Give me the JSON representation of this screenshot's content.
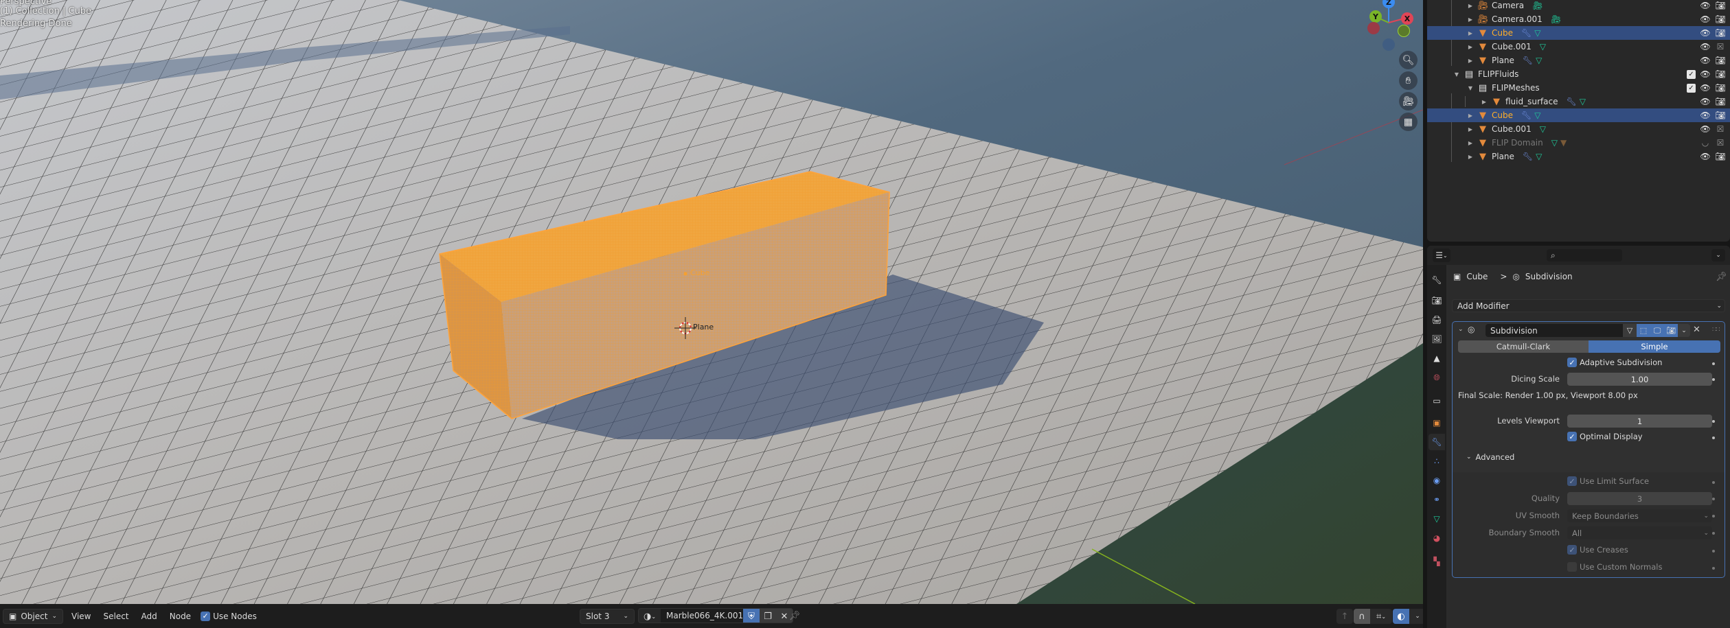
{
  "viewport": {
    "overlay_lines": [
      "Perspective",
      "(1) Collection | Cube",
      "Rendering Done"
    ],
    "object_labels": {
      "cube": "Cube",
      "plane": "Plane"
    },
    "axes": {
      "x": "X",
      "y": "Y",
      "z": "Z"
    },
    "navigation_icons": [
      "zoom-icon",
      "pan-hand-icon",
      "camera-view-icon",
      "ortho-grid-icon"
    ],
    "colors": {
      "selection": "#f5a030",
      "active_tab": "#4772b3",
      "selected_row": "#334d80"
    }
  },
  "header": {
    "mode": "Object",
    "menus": [
      "View",
      "Select",
      "Add",
      "Node"
    ],
    "use_nodes_label": "Use Nodes",
    "use_nodes_checked": true,
    "slot": "Slot 3",
    "material_name": "Marble066_4K.001"
  },
  "outliner": {
    "rows": [
      {
        "name": "Camera",
        "type": "camera",
        "indent": 2,
        "extras": [
          "camera-data"
        ],
        "selected": false,
        "render": "on"
      },
      {
        "name": "Camera.001",
        "type": "camera",
        "indent": 2,
        "extras": [
          "camera-data"
        ],
        "selected": false,
        "render": "on"
      },
      {
        "name": "Cube",
        "type": "mesh",
        "indent": 2,
        "extras": [
          "modifier",
          "mesh-data"
        ],
        "selected": true,
        "render": "on"
      },
      {
        "name": "Cube.001",
        "type": "mesh",
        "indent": 2,
        "extras": [
          "mesh-data"
        ],
        "selected": false,
        "render": "off"
      },
      {
        "name": "Plane",
        "type": "mesh",
        "indent": 2,
        "extras": [
          "modifier",
          "mesh-data"
        ],
        "selected": false,
        "render": "on"
      },
      {
        "name": "FLIPFluids",
        "type": "collection",
        "indent": 1,
        "expanded": true,
        "checkbox": true,
        "render": "on"
      },
      {
        "name": "FLIPMeshes",
        "type": "collection",
        "indent": 2,
        "expanded": true,
        "checkbox": true,
        "render": "on"
      },
      {
        "name": "fluid_surface",
        "type": "mesh",
        "indent": 3,
        "extras": [
          "modifier",
          "mesh-data"
        ],
        "render": "on"
      },
      {
        "name": "Cube",
        "type": "mesh",
        "indent": 2,
        "extras": [
          "modifier",
          "mesh-data"
        ],
        "selected": true,
        "render": "on"
      },
      {
        "name": "Cube.001",
        "type": "mesh",
        "indent": 2,
        "extras": [
          "mesh-data"
        ],
        "render": "off"
      },
      {
        "name": "FLIP Domain",
        "type": "mesh",
        "indent": 2,
        "extras": [
          "mesh-data",
          "mesh-object"
        ],
        "dim": true,
        "render": "off"
      },
      {
        "name": "Plane",
        "type": "mesh",
        "indent": 2,
        "extras": [
          "modifier",
          "mesh-data"
        ],
        "render": "on"
      }
    ]
  },
  "properties": {
    "search_placeholder": "",
    "breadcrumb": {
      "object": "Cube",
      "separator": ">",
      "modifier": "Subdivision"
    },
    "add_modifier": "Add Modifier",
    "modifier": {
      "name": "Subdivision",
      "tabs": [
        "Catmull-Clark",
        "Simple"
      ],
      "active_tab": "Simple",
      "adaptive_subdivision_label": "Adaptive Subdivision",
      "adaptive_subdivision": true,
      "dicing_scale_label": "Dicing Scale",
      "dicing_scale": "1.00",
      "final_scale": "Final Scale: Render 1.00 px, Viewport 8.00 px",
      "levels_viewport_label": "Levels Viewport",
      "levels_viewport": "1",
      "optimal_display_label": "Optimal Display",
      "optimal_display": true,
      "advanced_label": "Advanced",
      "advanced": {
        "use_limit_surface_label": "Use Limit Surface",
        "use_limit_surface": true,
        "quality_label": "Quality",
        "quality": "3",
        "uv_smooth_label": "UV Smooth",
        "uv_smooth": "Keep Boundaries",
        "boundary_smooth_label": "Boundary Smooth",
        "boundary_smooth": "All",
        "use_creases_label": "Use Creases",
        "use_creases": true,
        "use_custom_normals_label": "Use Custom Normals",
        "use_custom_normals": false
      }
    },
    "tabs": [
      "tool",
      "render",
      "output",
      "view-layer",
      "scene",
      "world",
      "collection",
      "object",
      "modifiers",
      "particles",
      "physics",
      "constraints",
      "data",
      "material",
      "texture"
    ],
    "active_tab": "modifiers"
  }
}
